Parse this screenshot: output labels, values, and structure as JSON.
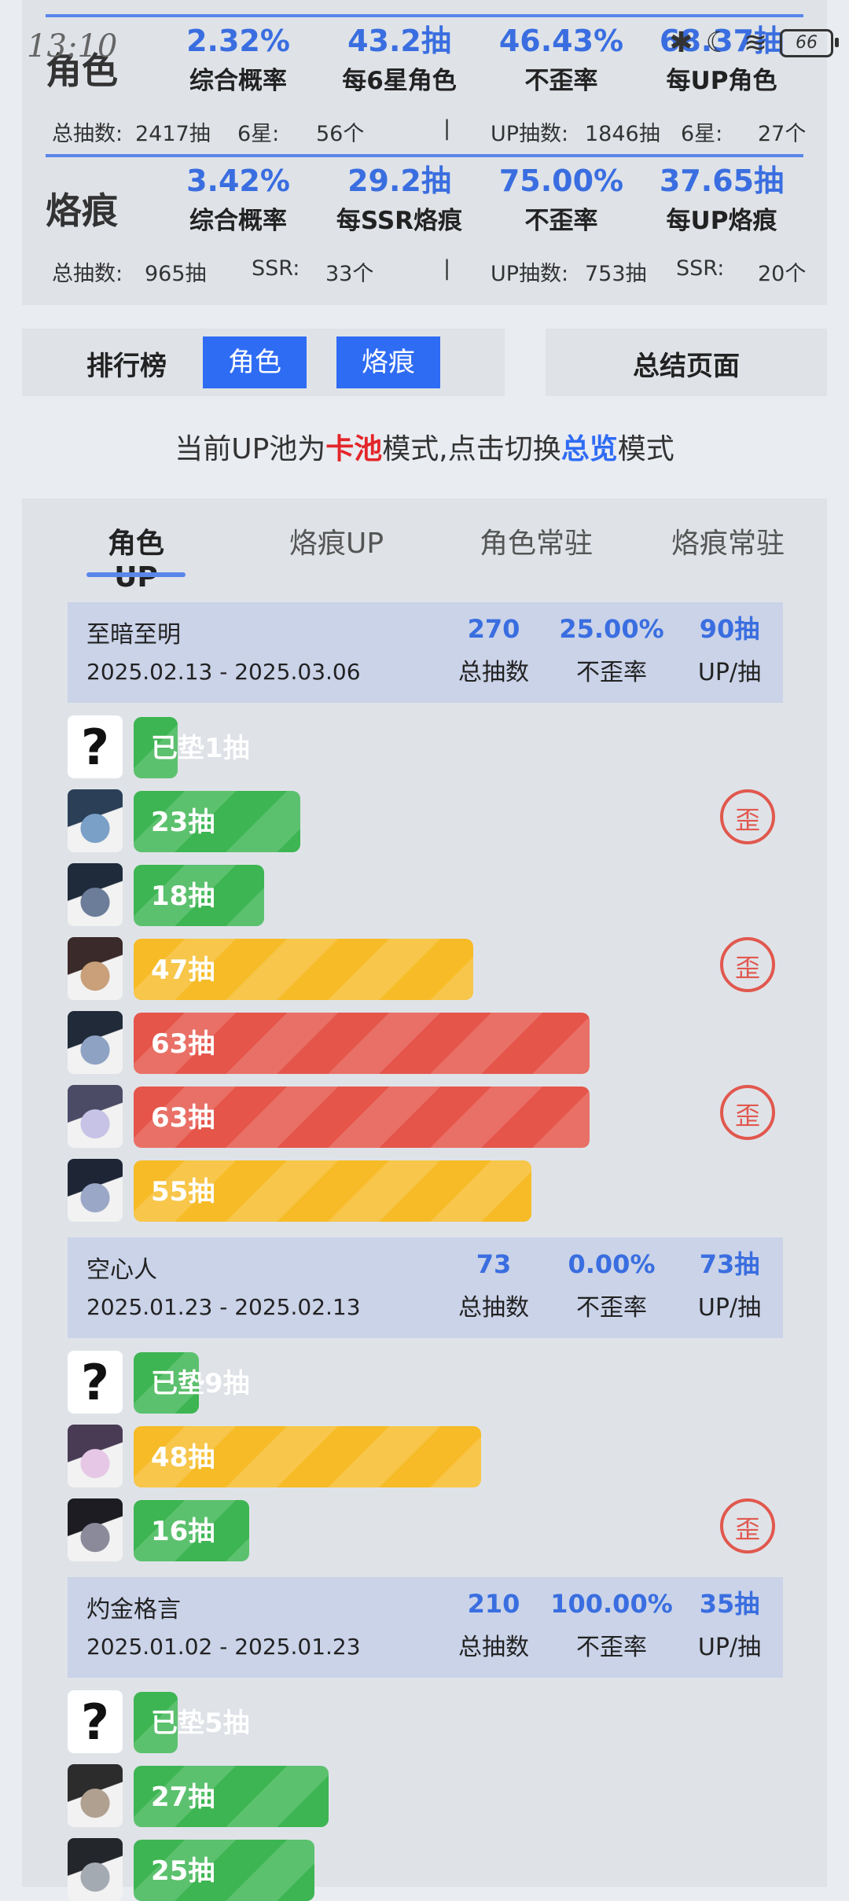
{
  "status": {
    "time": "13:10",
    "battery": "66"
  },
  "character_stats": {
    "title": "角色",
    "metrics": [
      {
        "value": "2.32%",
        "label": "综合概率"
      },
      {
        "value": "43.2抽",
        "label": "每6星角色"
      },
      {
        "value": "46.43%",
        "label": "不歪率"
      },
      {
        "value": "68.37抽",
        "label": "每UP角色"
      }
    ],
    "summary": {
      "total_label": "总抽数:",
      "total": "2417抽",
      "star_label": "6星:",
      "star": "56个",
      "sep": "|",
      "up_label": "UP抽数:",
      "up": "1846抽",
      "star2_label": "6星:",
      "star2": "27个"
    }
  },
  "brand_stats": {
    "title": "烙痕",
    "metrics": [
      {
        "value": "3.42%",
        "label": "综合概率"
      },
      {
        "value": "29.2抽",
        "label": "每SSR烙痕"
      },
      {
        "value": "75.00%",
        "label": "不歪率"
      },
      {
        "value": "37.65抽",
        "label": "每UP烙痕"
      }
    ],
    "summary": {
      "total_label": "总抽数:",
      "total": "965抽",
      "star_label": "SSR:",
      "star": "33个",
      "sep": "|",
      "up_label": "UP抽数:",
      "up": "753抽",
      "star2_label": "SSR:",
      "star2": "20个"
    }
  },
  "ranking": {
    "title": "排行榜",
    "btn_character": "角色",
    "btn_brand": "烙痕"
  },
  "summary_page": "总结页面",
  "mode_line": {
    "prefix": "当前UP池为",
    "mode": "卡池",
    "middle": "模式,点击切换",
    "alt": "总览",
    "suffix": "模式"
  },
  "tabs": [
    "角色UP",
    "烙痕UP",
    "角色常驻",
    "烙痕常驻"
  ],
  "pool_labels": {
    "total": "总抽数",
    "rate": "不歪率",
    "per_up": "UP/抽"
  },
  "pools": [
    {
      "name": "至暗至明",
      "dates": "2025.02.13 - 2025.03.06",
      "total": "270",
      "rate": "25.00%",
      "per_up": "90抽",
      "rows": [
        {
          "label": "已垫1抽",
          "pulls": 1,
          "color": "green",
          "unknown": true,
          "off": false
        },
        {
          "label": "23抽",
          "pulls": 23,
          "color": "green",
          "unknown": false,
          "off": true
        },
        {
          "label": "18抽",
          "pulls": 18,
          "color": "green",
          "unknown": false,
          "off": false
        },
        {
          "label": "47抽",
          "pulls": 47,
          "color": "yellow",
          "unknown": false,
          "off": true
        },
        {
          "label": "63抽",
          "pulls": 63,
          "color": "red",
          "unknown": false,
          "off": false
        },
        {
          "label": "63抽",
          "pulls": 63,
          "color": "red",
          "unknown": false,
          "off": true
        },
        {
          "label": "55抽",
          "pulls": 55,
          "color": "yellow",
          "unknown": false,
          "off": false
        }
      ]
    },
    {
      "name": "空心人",
      "dates": "2025.01.23 - 2025.02.13",
      "total": "73",
      "rate": "0.00%",
      "per_up": "73抽",
      "rows": [
        {
          "label": "已垫9抽",
          "pulls": 9,
          "color": "green",
          "unknown": true,
          "off": false
        },
        {
          "label": "48抽",
          "pulls": 48,
          "color": "yellow",
          "unknown": false,
          "off": false
        },
        {
          "label": "16抽",
          "pulls": 16,
          "color": "green",
          "unknown": false,
          "off": true
        }
      ]
    },
    {
      "name": "灼金格言",
      "dates": "2025.01.02 - 2025.01.23",
      "total": "210",
      "rate": "100.00%",
      "per_up": "35抽",
      "rows": [
        {
          "label": "已垫5抽",
          "pulls": 5,
          "color": "green",
          "unknown": true,
          "off": false
        },
        {
          "label": "27抽",
          "pulls": 27,
          "color": "green",
          "unknown": false,
          "off": false
        },
        {
          "label": "25抽",
          "pulls": 25,
          "color": "green",
          "unknown": false,
          "off": false
        }
      ]
    }
  ],
  "off_label": "歪",
  "unknown_glyph": "?",
  "colors": {
    "accent": "#2f6cf4",
    "green": "#3db552",
    "yellow": "#f6bb27",
    "red": "#e5554a"
  }
}
